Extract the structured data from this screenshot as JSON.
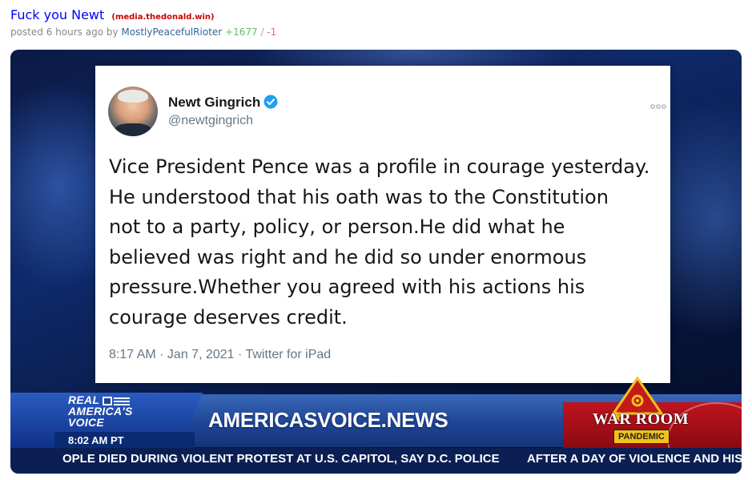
{
  "post": {
    "title": "Fuck you Newt",
    "domain": "(media.thedonald.win)",
    "meta_prefix": "posted 6 hours ago by",
    "author": "MostlyPeacefulRioter",
    "upvotes": "+1677",
    "separator": "/",
    "downvotes": "-1"
  },
  "tweet": {
    "name": "Newt Gingrich",
    "handle": "@newtgingrich",
    "text_lines": [
      "Vice President Pence was a profile in courage yesterday.",
      "He understood that his oath was to the Constitution",
      "not to a party, policy, or person.He did what he",
      "believed was right and he did so under enormous",
      "pressure.Whether you agreed with his actions his",
      "courage deserves credit."
    ],
    "timestamp": "8:17 AM · Jan 7, 2021 · Twitter for iPad"
  },
  "broadcast": {
    "logo_lines": [
      "REAL",
      "AMERICA'S",
      "VOICE"
    ],
    "time": "8:02 AM PT",
    "headline": "AMERICASVOICE.NEWS",
    "ticker_left": "OPLE DIED DURING VIOLENT PROTEST AT U.S. CAPITOL, SAY D.C. POLICE",
    "ticker_right": "AFTER A DAY OF VIOLENCE AND HIS",
    "warroom_title": "WAR ROOM",
    "warroom_badge": "PANDEMIC"
  },
  "colors": {
    "link": "#0000ff",
    "domain": "#cc0000",
    "upvote": "#66bb66",
    "downvote": "#e07070",
    "verified": "#1da1f2",
    "warroom_red": "#c0141e"
  },
  "icons": {
    "verified": "verified-badge-icon",
    "more": "more-options-icon",
    "flag": "flag-icon",
    "emblem": "biohazard-emblem-icon"
  }
}
